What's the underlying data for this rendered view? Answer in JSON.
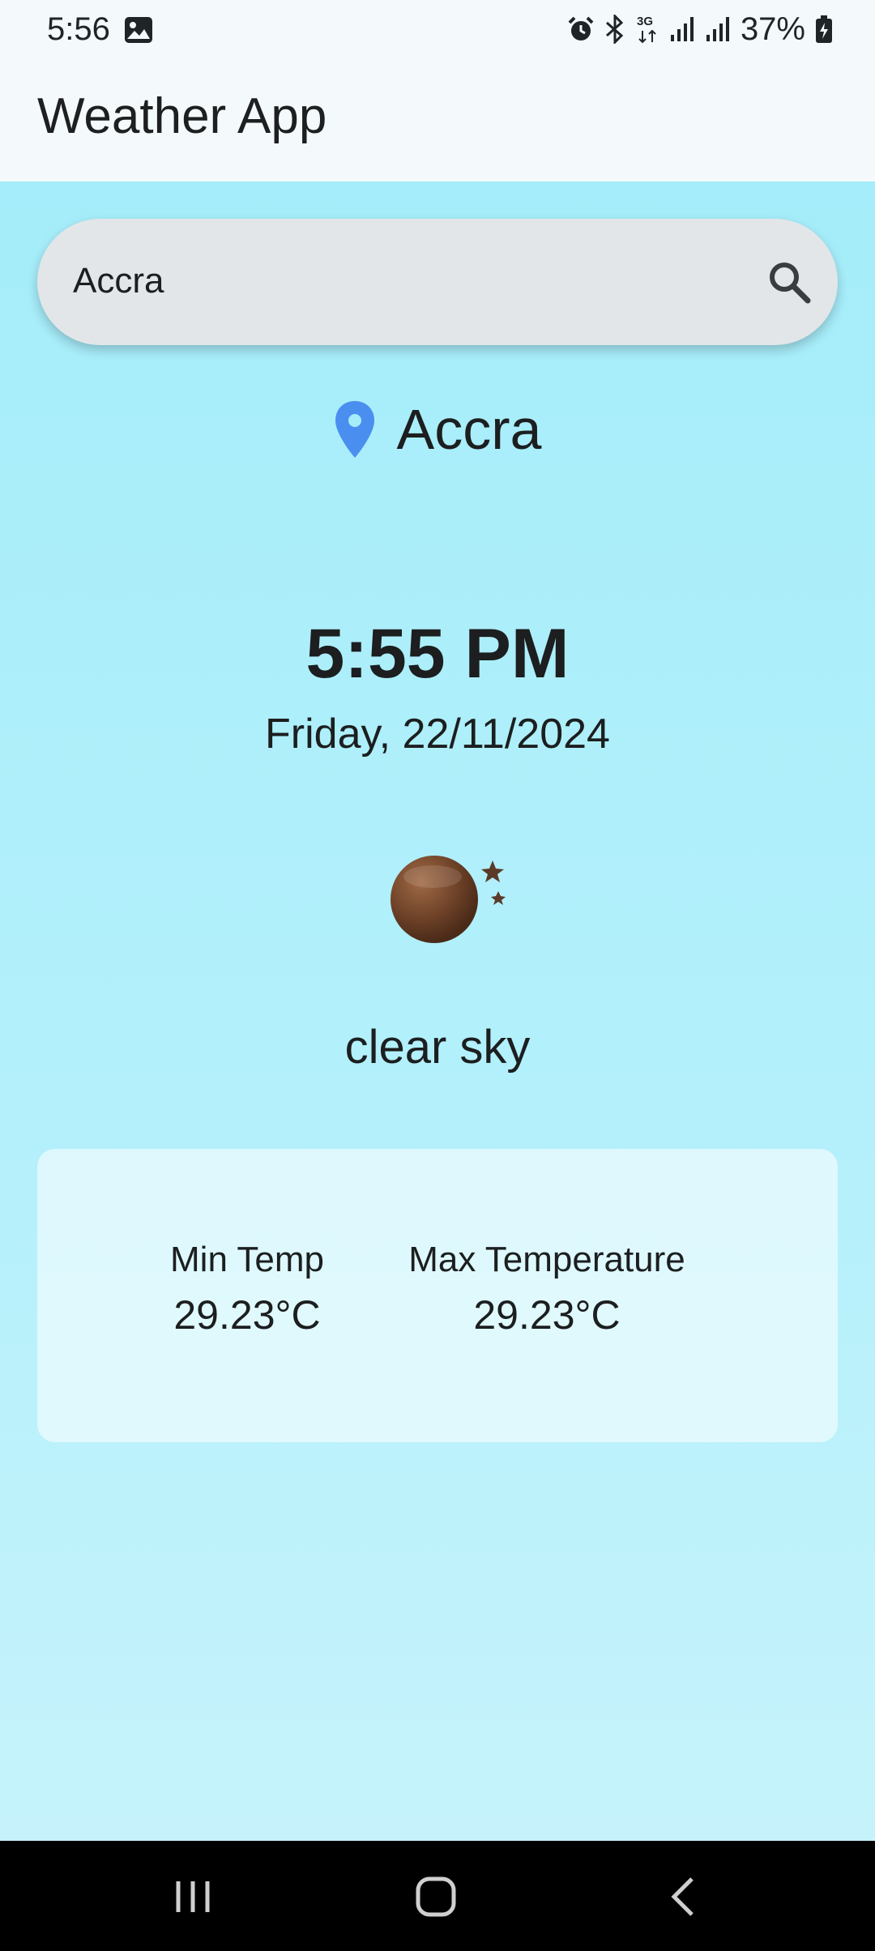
{
  "status_bar": {
    "time": "5:56",
    "battery_percent": "37%",
    "network_type": "3G",
    "icons": [
      "gallery-icon",
      "alarm-icon",
      "bluetooth-icon",
      "3g-icon",
      "signal-icon",
      "signal-icon",
      "battery-charging-icon"
    ]
  },
  "app_bar": {
    "title": "Weather App"
  },
  "search": {
    "value": "Accra",
    "icon": "search-icon"
  },
  "location": {
    "name": "Accra",
    "icon": "location-pin-icon",
    "icon_color": "#4a8ef0"
  },
  "clock": {
    "time": "5:55 PM",
    "date": "Friday, 22/11/2024"
  },
  "weather": {
    "icon": "clear-sky-night-icon",
    "description": "clear sky"
  },
  "temperatures": {
    "min_label": "Min Temp",
    "min_value": "29.23°C",
    "max_label": "Max Temperature",
    "max_value": "29.23°C"
  },
  "nav_bar": {
    "buttons": [
      "recent-apps-icon",
      "home-icon",
      "back-icon"
    ]
  },
  "colors": {
    "background_top": "#a5edfa",
    "background_bottom": "#c6f3fb",
    "search_bg": "#e2e6e8",
    "accent": "#4a8ef0"
  }
}
